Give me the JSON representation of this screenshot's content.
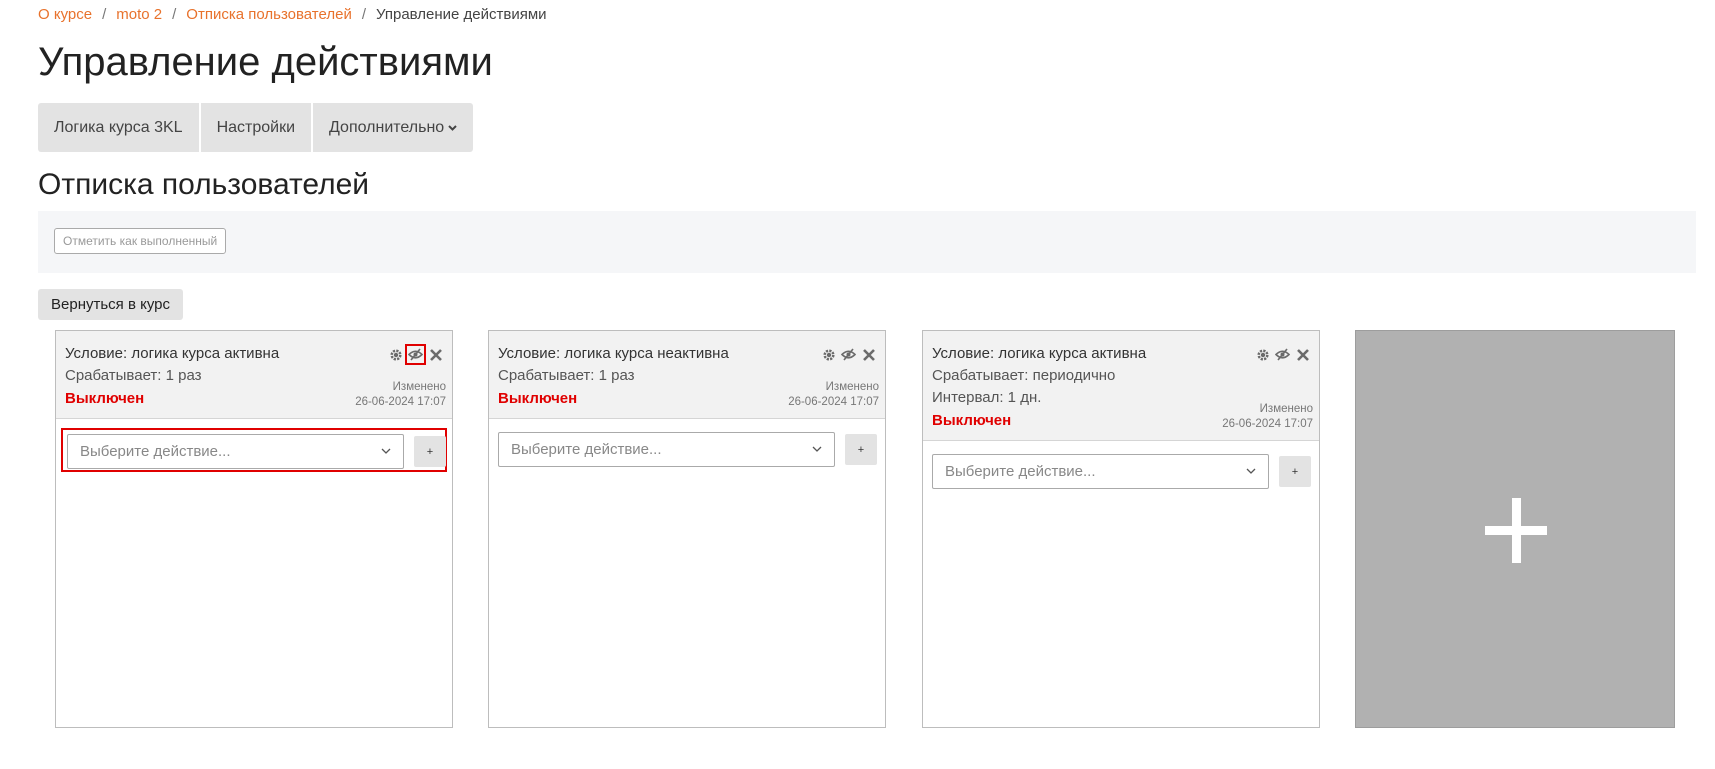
{
  "breadcrumb": {
    "items": [
      "О курсе",
      "moto 2",
      "Отписка пользователей"
    ],
    "current": "Управление действиями",
    "separator": "/"
  },
  "page_title": "Управление действиями",
  "tabs": [
    {
      "label": "Логика курса 3KL"
    },
    {
      "label": "Настройки"
    },
    {
      "label": "Дополнительно"
    }
  ],
  "section_title": "Отписка пользователей",
  "completion_button": "Отметить как выполненный",
  "back_button": "Вернуться в курс",
  "cards": [
    {
      "condition": "Условие: логика курса активна",
      "trigger": "Срабатывает: 1 раз",
      "interval": "",
      "status": "Выключен",
      "changed_label": "Изменено",
      "changed_date": "26-06-2024 17:07",
      "select_placeholder": "Выберите действие...",
      "add_label": "+"
    },
    {
      "condition": "Условие: логика курса неактивна",
      "trigger": "Срабатывает: 1 раз",
      "interval": "",
      "status": "Выключен",
      "changed_label": "Изменено",
      "changed_date": "26-06-2024 17:07",
      "select_placeholder": "Выберите действие...",
      "add_label": "+"
    },
    {
      "condition": "Условие: логика курса активна",
      "trigger": "Срабатывает: периодично",
      "interval": "Интервал: 1 дн.",
      "status": "Выключен",
      "changed_label": "Изменено",
      "changed_date": "26-06-2024 17:07",
      "select_placeholder": "Выберите действие...",
      "add_label": "+"
    }
  ],
  "icons": {
    "settings": "gear-icon",
    "visibility": "eye-slash-icon",
    "delete": "close-icon",
    "dropdown": "chevron-down-icon",
    "add_card": "plus-icon"
  },
  "colors": {
    "link": "#e8722c",
    "status_off": "#e00000",
    "highlight": "#e00000",
    "add_card_bg": "#b1b1b1"
  }
}
